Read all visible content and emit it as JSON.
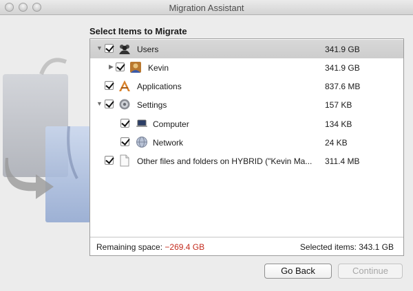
{
  "window": {
    "title": "Migration Assistant"
  },
  "heading": "Select Items to Migrate",
  "items": [
    {
      "label": "Users",
      "size": "341.9 GB",
      "icon": "users-icon",
      "expanded": true,
      "checked": true,
      "selected": true
    },
    {
      "label": "Kevin",
      "size": "341.9 GB",
      "icon": "user-kevin-icon",
      "expanded": false,
      "checked": true
    },
    {
      "label": "Applications",
      "size": "837.6 MB",
      "icon": "applications-icon",
      "checked": true
    },
    {
      "label": "Settings",
      "size": "157 KB",
      "icon": "settings-gear-icon",
      "expanded": true,
      "checked": true
    },
    {
      "label": "Computer",
      "size": "134 KB",
      "icon": "laptop-icon",
      "checked": true
    },
    {
      "label": "Network",
      "size": "24 KB",
      "icon": "network-globe-icon",
      "checked": true
    },
    {
      "label": "Other files and folders on HYBRID (\"Kevin Ma...",
      "size": "311.4 MB",
      "icon": "document-icon",
      "checked": true
    }
  ],
  "footer": {
    "remaining_label": "Remaining space:",
    "remaining_value": "−269.4 GB",
    "selected_label": "Selected items:",
    "selected_value": "343.1 GB"
  },
  "buttons": {
    "back": "Go Back",
    "continue": "Continue"
  },
  "colors": {
    "negative": "#c32a1c",
    "selected_row": "#d3d3d3"
  }
}
